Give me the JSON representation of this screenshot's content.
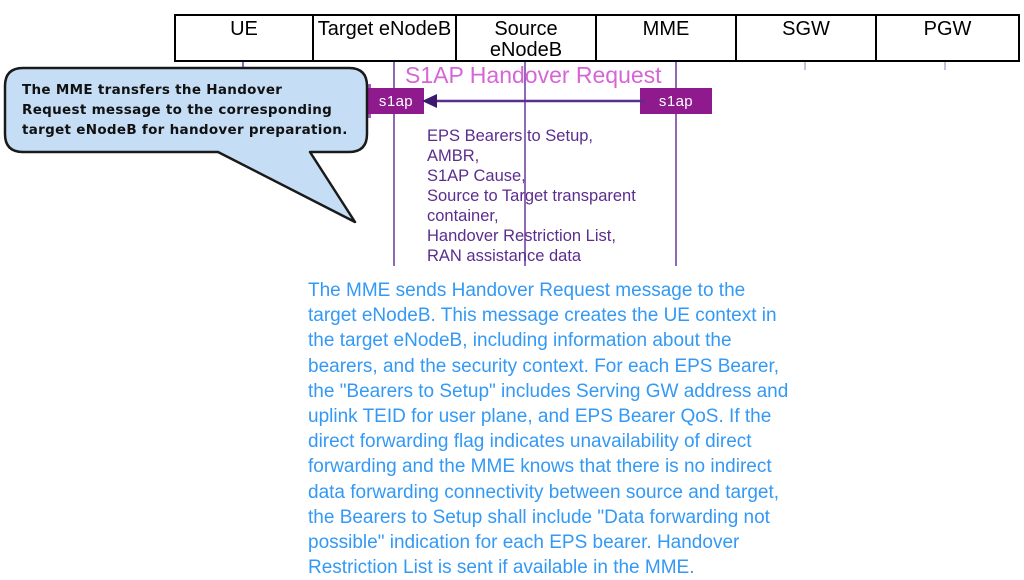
{
  "diagram": {
    "title": "S1AP Handover Request",
    "nodes": [
      {
        "label": "UE"
      },
      {
        "label": "Target eNodeB"
      },
      {
        "label": "Source eNodeB"
      },
      {
        "label": "MME"
      },
      {
        "label": "SGW"
      },
      {
        "label": "PGW"
      }
    ],
    "protocol_boxes": [
      {
        "label": "s1ap",
        "side": "target-enodeb"
      },
      {
        "label": "s1ap",
        "side": "mme"
      }
    ],
    "arrow": {
      "direction": "right-to-left",
      "from": "MME",
      "to": "Target eNodeB",
      "color": "#5b2d8e"
    },
    "callout": {
      "lines": [
        "The MME transfers the Handover",
        "Request message to the corresponding",
        "target eNodeB for handover preparation."
      ],
      "fill_color": "#c5def5",
      "border_color": "#1a1a1a"
    },
    "parameters": {
      "color": "#5b2d8e",
      "lines": [
        "EPS Bearers to Setup,",
        "AMBR,",
        "S1AP Cause,",
        "Source to Target transparent",
        "container,",
        "Handover Restriction List,",
        "RAN assistance data"
      ]
    },
    "description": {
      "color": "#3399f5",
      "lines": [
        "The MME sends Handover Request message to the",
        "target eNodeB. This message creates the UE context in",
        "the target eNodeB, including information about the",
        "bearers, and the security context. For each EPS Bearer,",
        "the \"Bearers to Setup\" includes Serving GW address and",
        "uplink TEID for user plane, and EPS Bearer QoS. If the",
        "direct forwarding flag indicates unavailability of direct",
        "forwarding and the MME knows that there is no indirect",
        "data forwarding connectivity between source and target,",
        "the Bearers to Setup shall include \"Data forwarding not",
        "possible\" indication for each EPS bearer. Handover",
        "Restriction List is sent if available in the MME."
      ]
    },
    "colors": {
      "title_magenta": "#d666d6",
      "protocol_box": "#8e1a8e",
      "activation_bar": "#a45cc4",
      "lifeline": "#7b4fa8"
    }
  }
}
